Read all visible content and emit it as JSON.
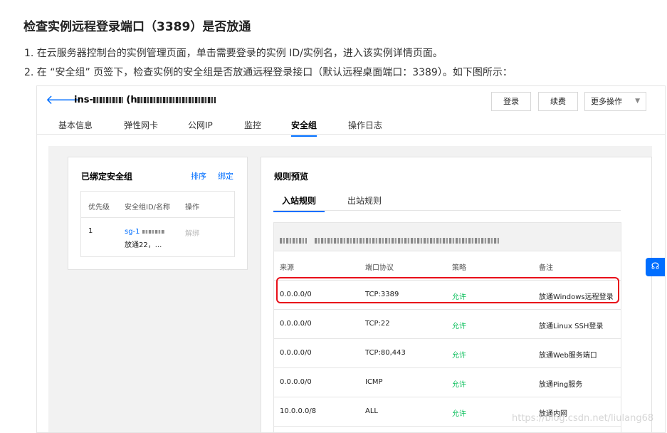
{
  "doc": {
    "heading": "检查实例远程登录端口（3389）是否放通",
    "step1": "1. 在云服务器控制台的实例管理页面，单击需要登录的实例 ID/实例名，进入该实例详情页面。",
    "step2": "2. 在 “安全组” 页签下，检查实例的安全组是否放通远程登录接口（默认远程桌面端口：3389）。如下图所示："
  },
  "screenshot": {
    "instance_title_prefix": "ins-",
    "instance_title_mid": "(h",
    "buttons": {
      "login": "登录",
      "renew": "续费",
      "more": "更多操作"
    },
    "tabs": [
      "基本信息",
      "弹性网卡",
      "公网IP",
      "监控",
      "安全组",
      "操作日志"
    ],
    "active_tab": "安全组",
    "bound_sg": {
      "title": "已绑定安全组",
      "sort_link": "排序",
      "bind_link": "绑定",
      "columns": [
        "优先级",
        "安全组ID/名称",
        "操作"
      ],
      "row": {
        "priority": "1",
        "id": "sg-1",
        "name": "放通22，...",
        "action": "解绑"
      }
    },
    "rules": {
      "title": "规则预览",
      "tabs": [
        "入站规则",
        "出站规则"
      ],
      "active_tab": "入站规则",
      "columns": [
        "来源",
        "端口协议",
        "策略",
        "备注"
      ],
      "rows": [
        {
          "source": "0.0.0.0/0",
          "port": "TCP:3389",
          "policy": "允许",
          "note": "放通Windows远程登录"
        },
        {
          "source": "0.0.0.0/0",
          "port": "TCP:22",
          "policy": "允许",
          "note": "放通Linux SSH登录"
        },
        {
          "source": "0.0.0.0/0",
          "port": "TCP:80,443",
          "policy": "允许",
          "note": "放通Web服务端口"
        },
        {
          "source": "0.0.0.0/0",
          "port": "ICMP",
          "policy": "允许",
          "note": "放通Ping服务"
        },
        {
          "source": "10.0.0.0/8",
          "port": "ALL",
          "policy": "允许",
          "note": "放通内网"
        }
      ]
    }
  },
  "watermark": "https://blog.csdn.net/liulang68",
  "colors": {
    "accent": "#006eff",
    "allow": "#0abf5b",
    "highlight": "#e8101a"
  }
}
